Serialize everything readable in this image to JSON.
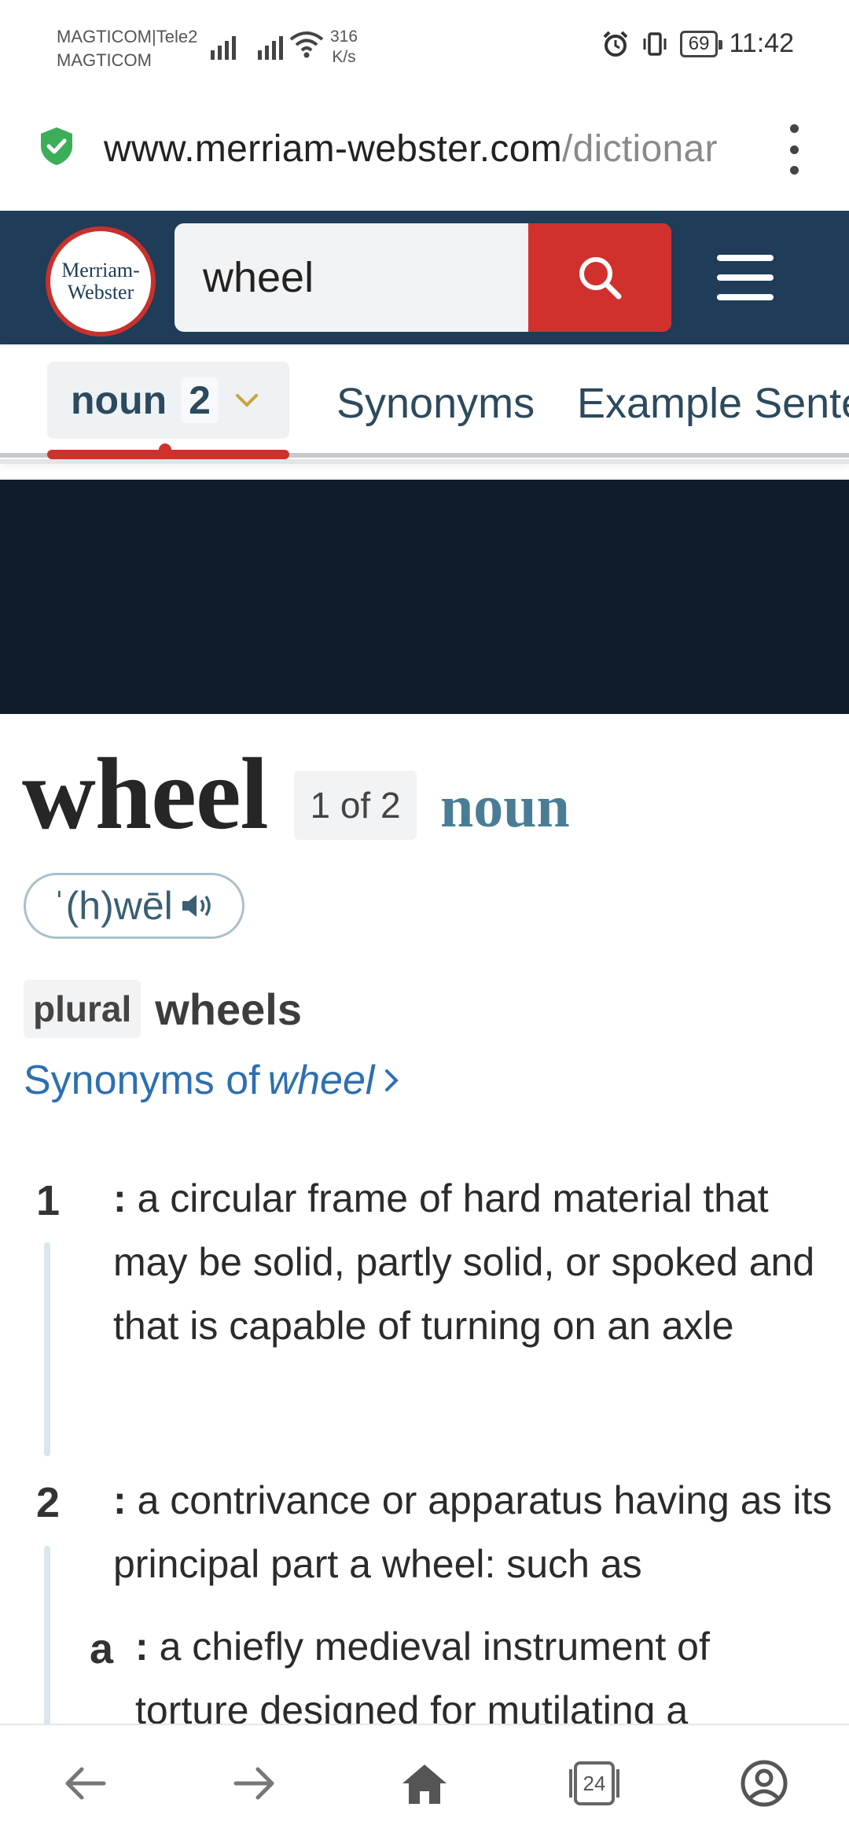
{
  "status_bar": {
    "carrier_1": "MAGTICOM|Tele2",
    "carrier_2": "MAGTICOM",
    "speed_value": "316",
    "speed_unit": "K/s",
    "battery": "69",
    "time": "11:42"
  },
  "url_bar": {
    "domain": "www.merriam-webster.com",
    "path": "/dictionar"
  },
  "header": {
    "logo_line1": "Merriam-",
    "logo_line2": "Webster",
    "search_value": "wheel"
  },
  "tabs": {
    "pos_label": "noun",
    "pos_count": "2",
    "synonyms": "Synonyms",
    "examples": "Example Sente"
  },
  "entry": {
    "headword": "wheel",
    "homograph": "1 of 2",
    "part_of_speech": "noun",
    "pronunciation": "ˈ(h)wēl",
    "plural_label": "plural",
    "plural_form": "wheels",
    "synonyms_prefix": "Synonyms of",
    "synonyms_word": "wheel",
    "senses": [
      {
        "num": "1",
        "colon": ":",
        "text": "a circular frame of hard material that may be solid, partly solid, or spoked and that is capable of turning on an axle"
      },
      {
        "num": "2",
        "colon": ":",
        "text": "a contrivance or apparatus having as its principal part a wheel: such as",
        "sub": [
          {
            "letter": "a",
            "colon": ":",
            "text": "a chiefly medieval instrument of torture designed for mutilating a"
          }
        ]
      }
    ]
  },
  "bottom_nav": {
    "tab_count": "24"
  },
  "colors": {
    "header_bg": "#1f3c58",
    "brand_red": "#d0312d",
    "link_blue": "#2e6fb0",
    "pos_teal": "#4a7d95"
  }
}
